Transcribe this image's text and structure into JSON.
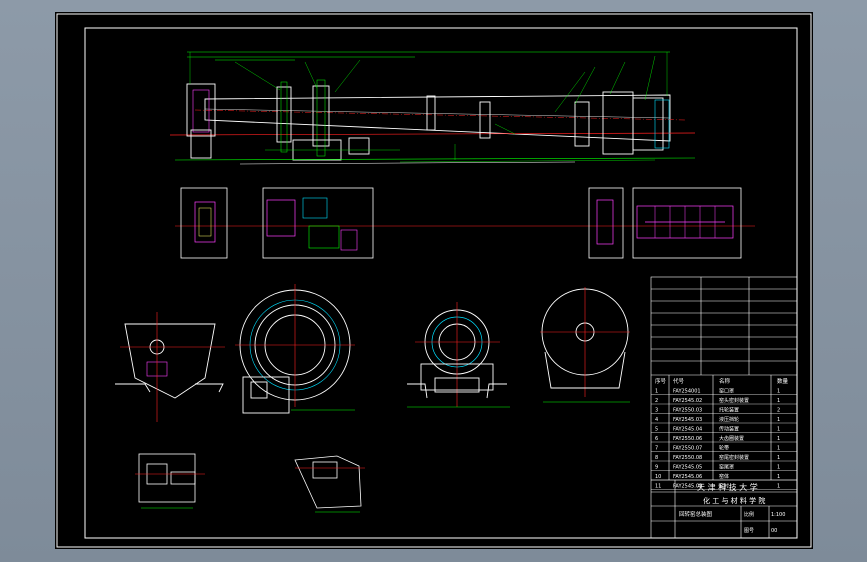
{
  "colors": {
    "background": "#7f8c99",
    "canvas": "#000000",
    "line": "#ffffff",
    "dimension": "#00ff00",
    "centerline": "#ff2020",
    "hatch": "#ff40ff",
    "highlight": "#00e0ff"
  },
  "parts_table": {
    "headers": [
      "序号",
      "代号",
      "名称",
      "数量"
    ],
    "rows": [
      {
        "no": "1",
        "code": "FAY254001",
        "name": "窑口罩",
        "qty": "1"
      },
      {
        "no": "2",
        "code": "FAY2545.02",
        "name": "窑头密封装置",
        "qty": "1"
      },
      {
        "no": "3",
        "code": "FAY2550.03",
        "name": "托轮装置",
        "qty": "2"
      },
      {
        "no": "4",
        "code": "FAY2545.03",
        "name": "液压挡轮",
        "qty": "1"
      },
      {
        "no": "5",
        "code": "FAY2545.04",
        "name": "传动装置",
        "qty": "1"
      },
      {
        "no": "6",
        "code": "FAY2550.06",
        "name": "大齿圈装置",
        "qty": "1"
      },
      {
        "no": "7",
        "code": "FAY2550.07",
        "name": "轮带",
        "qty": "1"
      },
      {
        "no": "8",
        "code": "FAY2550.08",
        "name": "窑尾密封装置",
        "qty": "1"
      },
      {
        "no": "9",
        "code": "FAY2545.05",
        "name": "窑尾罩",
        "qty": "1"
      },
      {
        "no": "10",
        "code": "FAY2545.06",
        "name": "窑体",
        "qty": "1"
      },
      {
        "no": "11",
        "code": "FAY2545.09",
        "name": "窑衬",
        "qty": "1"
      }
    ]
  },
  "title_block": {
    "university": "天 津 科 技 大 学",
    "department": "化 工 与 材 料 学 院",
    "drawing_title": "回转窑总装图",
    "scale_label": "比例",
    "scale_value": "1:100",
    "sheet_label": "图号",
    "sheet_value": "00"
  }
}
